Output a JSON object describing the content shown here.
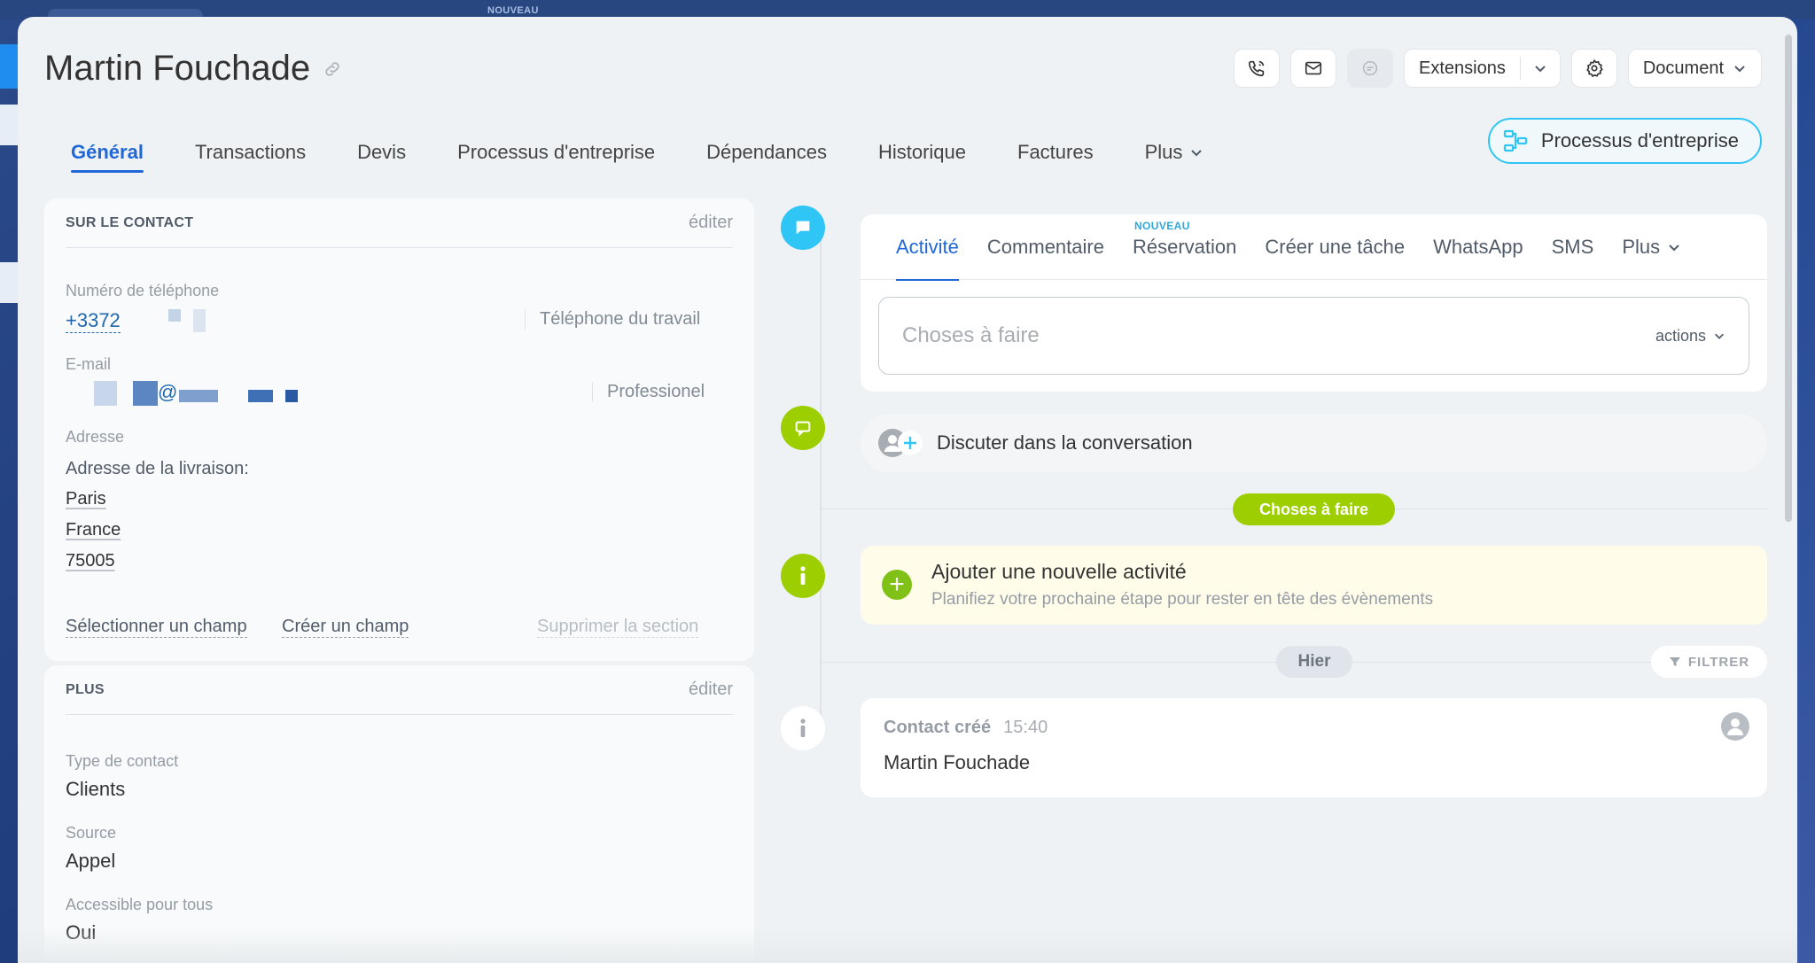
{
  "background": {
    "nouveau_label": "NOUVEAU"
  },
  "header": {
    "title": "Martin Fouchade",
    "extensions_label": "Extensions",
    "document_label": "Document"
  },
  "tabs": [
    {
      "label": "Général",
      "active": true
    },
    {
      "label": "Transactions"
    },
    {
      "label": "Devis"
    },
    {
      "label": "Processus d'entreprise"
    },
    {
      "label": "Dépendances"
    },
    {
      "label": "Historique"
    },
    {
      "label": "Factures"
    },
    {
      "label": "Plus"
    }
  ],
  "business_process_button": "Processus d'entreprise",
  "contact_card": {
    "title": "SUR LE CONTACT",
    "edit": "éditer",
    "phone_label": "Numéro de téléphone",
    "phone_value": "+3372",
    "phone_type": "Téléphone du travail",
    "email_label": "E-mail",
    "email_at": "@",
    "email_type": "Professionel",
    "address_label": "Adresse",
    "address_delivery": "Adresse de la livraison:",
    "address_city": "Paris",
    "address_country": "France",
    "address_zip": "75005",
    "select_field": "Sélectionner un champ",
    "create_field": "Créer un champ",
    "delete_section": "Supprimer la section"
  },
  "plus_card": {
    "title": "PLUS",
    "edit": "éditer",
    "contact_type_label": "Type de contact",
    "contact_type_value": "Clients",
    "source_label": "Source",
    "source_value": "Appel",
    "accessible_label": "Accessible pour tous",
    "accessible_value": "Oui"
  },
  "editor": {
    "tabs": [
      {
        "label": "Activité",
        "active": true
      },
      {
        "label": "Commentaire"
      },
      {
        "label": "Réservation",
        "badge": "NOUVEAU"
      },
      {
        "label": "Créer une tâche"
      },
      {
        "label": "WhatsApp"
      },
      {
        "label": "SMS"
      },
      {
        "label": "Plus"
      }
    ],
    "todo_placeholder": "Choses à faire",
    "actions_label": "actions"
  },
  "chat": {
    "label": "Discuter dans la conversation"
  },
  "timeline": {
    "todo_pill": "Choses à faire",
    "new_activity_title": "Ajouter une nouvelle activité",
    "new_activity_subtitle": "Planifiez votre prochaine étape pour rester en tête des évènements",
    "yesterday": "Hier",
    "filter": "FILTRER",
    "history_title": "Contact créé",
    "history_time": "15:40",
    "history_body": "Martin Fouchade"
  },
  "colors": {
    "accent_blue": "#2067d8",
    "cyan": "#2fc6f6",
    "green": "#9dcf00",
    "activity_yellow": "#fffdea"
  }
}
